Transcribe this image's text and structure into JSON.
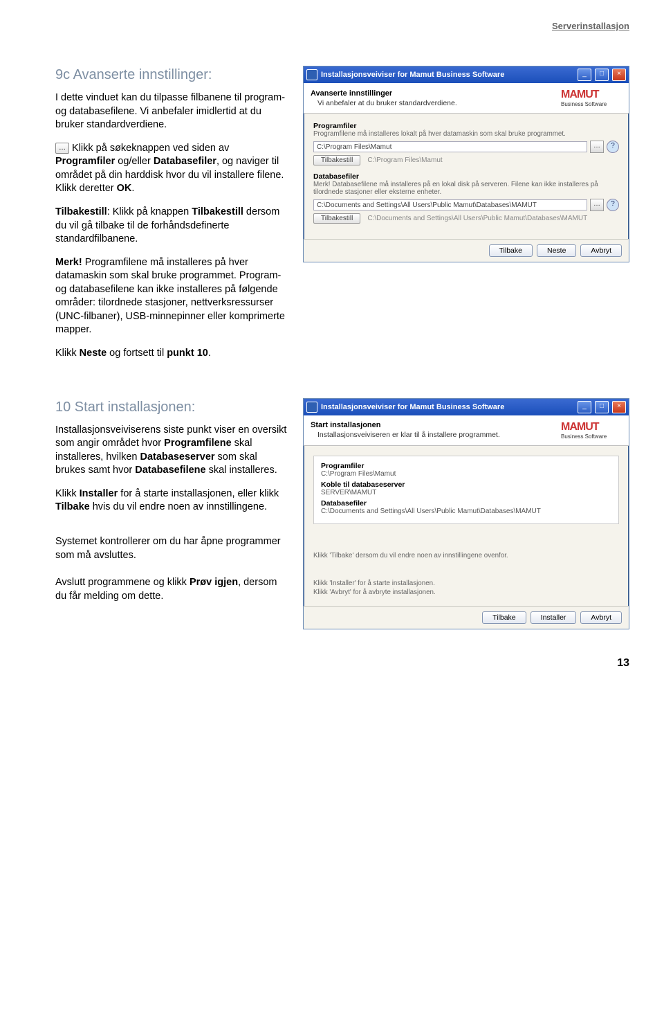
{
  "header": {
    "section": "Serverinstallasjon"
  },
  "step9c": {
    "title": "9c  Avanserte innstillinger:",
    "p1": "I dette vinduet kan du tilpasse filbanene til program- og databasefilene. Vi anbefaler imidlertid at du bruker standardverdiene.",
    "browse_icon": "…",
    "p2_a": " Klikk på søkeknappen ved siden av ",
    "p2_b1": "Programfiler",
    "p2_mid": " og/eller ",
    "p2_b2": "Databasefiler",
    "p2_c": ", og naviger til området på din harddisk hvor du vil installere filene. Klikk deretter ",
    "p2_b3": "OK",
    "p2_end": ".",
    "p3_b1": "Tilbakestill",
    "p3_a": ": Klikk på knappen ",
    "p3_b2": "Tilbakestill",
    "p3_c": " dersom du vil gå tilbake til de forhåndsdefinerte standardfilbanene.",
    "p4_b": "Merk!",
    "p4": " Programfilene må installeres på hver datamaskin som skal bruke programmet. Program- og databasefilene kan ikke installeres på følgende områder: tilordnede stasjoner, nettverksressurser (UNC-filbaner), USB-minnepinner eller komprimerte mapper.",
    "p5_a": "Klikk ",
    "p5_b1": "Neste",
    "p5_mid": " og fortsett til ",
    "p5_b2": "punkt 10",
    "p5_end": "."
  },
  "wiz1": {
    "title": "Installasjonsveiviser for Mamut Business Software",
    "logo": {
      "main": "MAMUT",
      "sub": "Business Software"
    },
    "header": {
      "t": "Avanserte innstillinger",
      "s": "Vi anbefaler at du bruker standardverdiene."
    },
    "prog": {
      "label": "Programfiler",
      "desc": "Programfilene må installeres lokalt på hver datamaskin som skal bruke programmet.",
      "path": "C:\\Program Files\\Mamut",
      "reset_label": "Tilbakestill",
      "reset_path": "C:\\Program Files\\Mamut"
    },
    "db": {
      "label": "Databasefiler",
      "desc": "Merk! Databasefilene må installeres på en lokal disk på serveren. Filene kan ikke installeres på tilordnede stasjoner eller eksterne enheter.",
      "path": "C:\\Documents and Settings\\All Users\\Public Mamut\\Databases\\MAMUT",
      "reset_label": "Tilbakestill",
      "reset_path": "C:\\Documents and Settings\\All Users\\Public Mamut\\Databases\\MAMUT"
    },
    "buttons": {
      "back": "Tilbake",
      "next": "Neste",
      "cancel": "Avbryt"
    }
  },
  "step10": {
    "title": "10  Start installasjonen:",
    "p1_a": "Installasjonsveiviserens siste punkt viser en oversikt som angir området hvor ",
    "p1_b1": "Programfilene",
    "p1_mid1": " skal installeres, hvilken ",
    "p1_b2": "Databaseserver",
    "p1_mid2": " som skal brukes samt hvor ",
    "p1_b3": "Databasefilene",
    "p1_end": " skal installeres.",
    "p2_a": "Klikk ",
    "p2_b1": "Installer",
    "p2_mid": " for å starte installasjonen, eller klikk ",
    "p2_b2": "Tilbake",
    "p2_end": " hvis du vil endre noen av innstillingene.",
    "p3": "Systemet kontrollerer om du har åpne programmer som må avsluttes.",
    "p4_a": "Avslutt programmene og klikk ",
    "p4_b": "Prøv igjen",
    "p4_end": ", dersom du får melding om dette."
  },
  "wiz2": {
    "title": "Installasjonsveiviser for Mamut Business Software",
    "header": {
      "t": "Start installasjonen",
      "s": "Installasjonsveiviseren er klar til å installere programmet."
    },
    "sum": {
      "prog_l": "Programfiler",
      "prog_v": "C:\\Program Files\\Mamut",
      "srv_l": "Koble til databaseserver",
      "srv_v": "SERVER\\MAMUT",
      "db_l": "Databasefiler",
      "db_v": "C:\\Documents and Settings\\All Users\\Public Mamut\\Databases\\MAMUT"
    },
    "note1": "Klikk 'Tilbake' dersom du vil endre noen av innstillingene ovenfor.",
    "note2": "Klikk 'Installer' for å starte installasjonen.\nKlikk 'Avbryt' for å avbryte installasjonen.",
    "buttons": {
      "back": "Tilbake",
      "install": "Installer",
      "cancel": "Avbryt"
    }
  },
  "page_num": "13"
}
